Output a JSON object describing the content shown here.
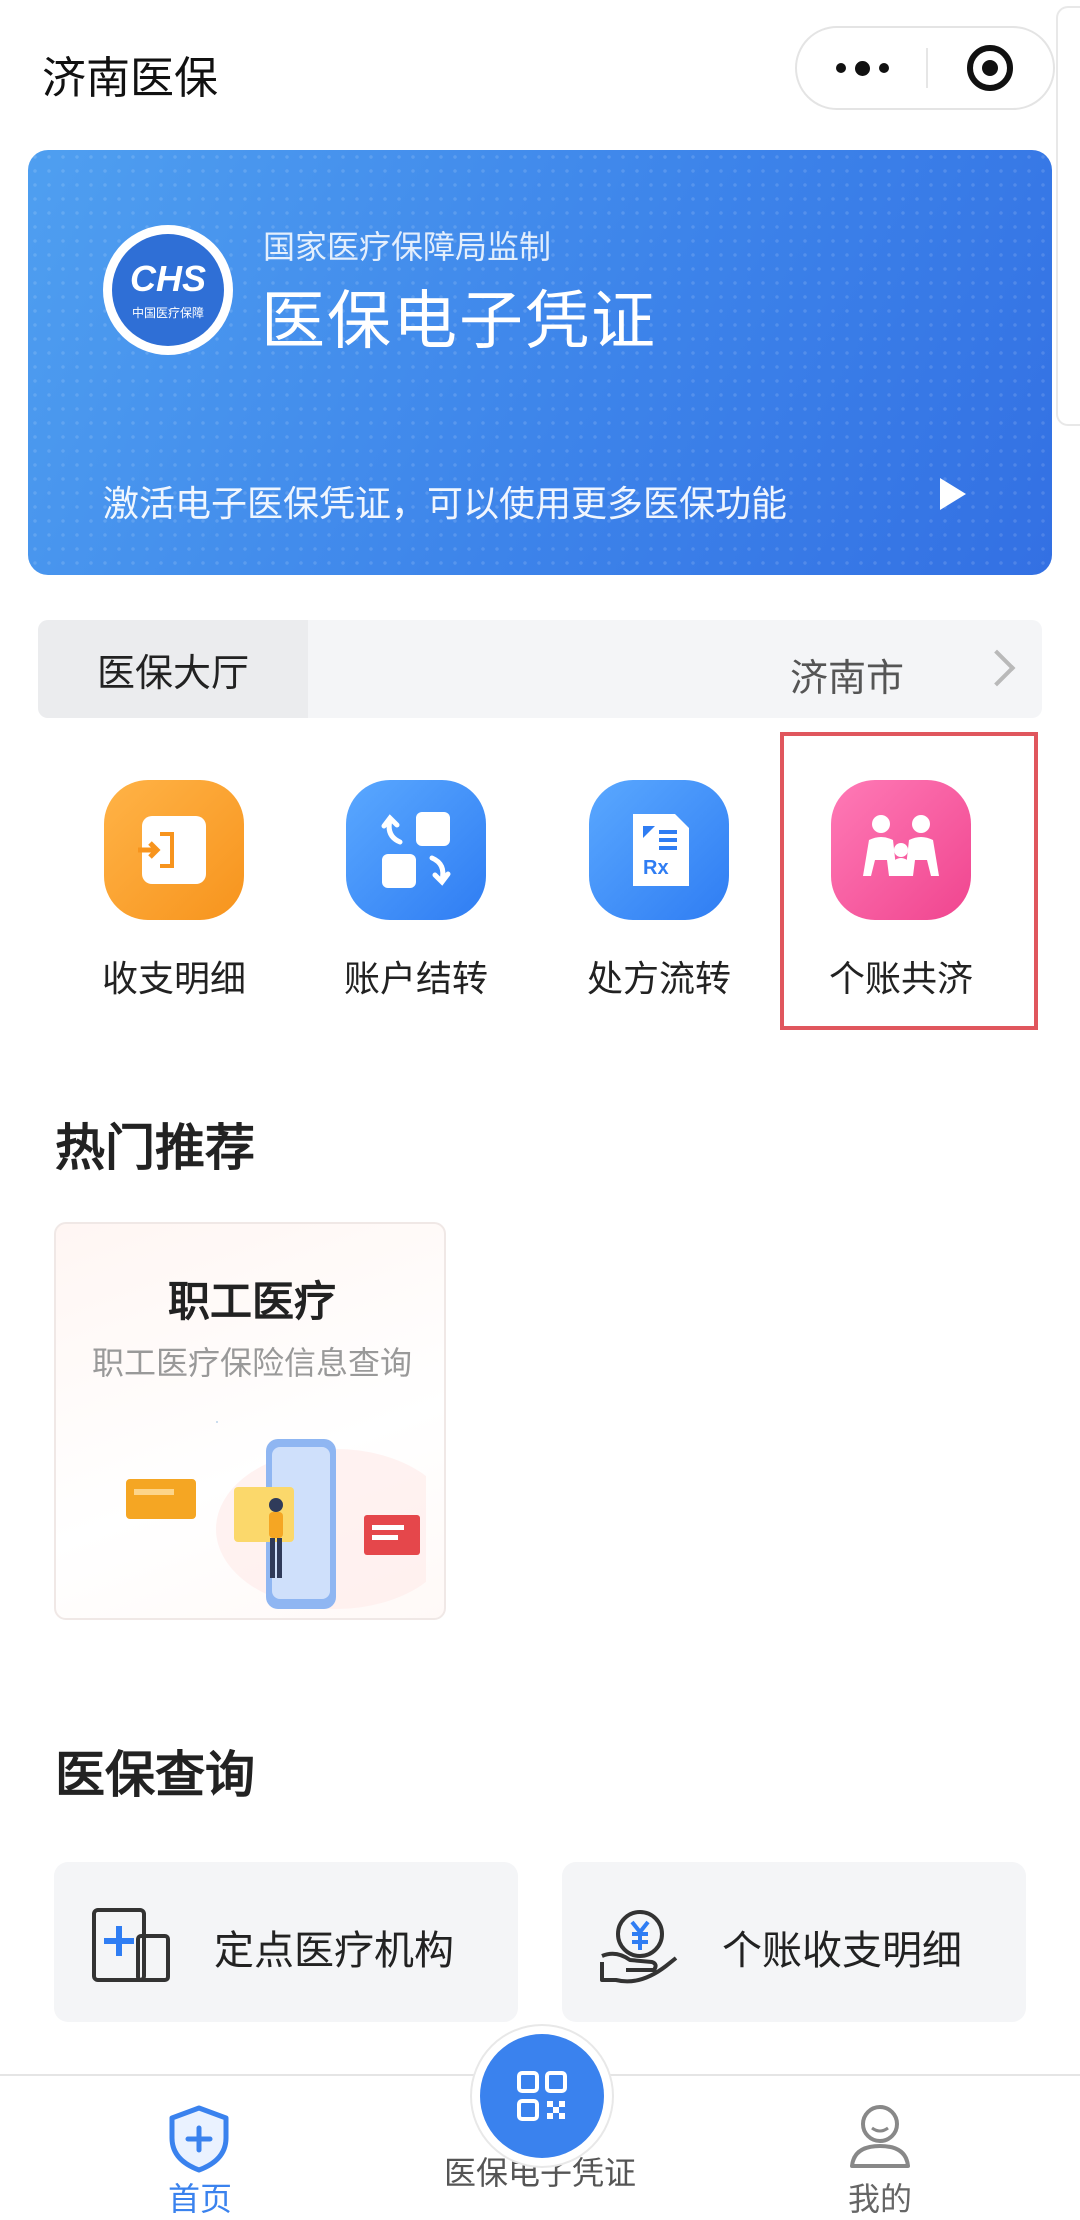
{
  "header": {
    "title": "济南医保"
  },
  "banner": {
    "logo_text": "CHS",
    "logo_subtext": "中国医疗保障",
    "subtitle": "国家医疗保障局监制",
    "title": "医保电子凭证",
    "hint": "激活电子医保凭证，可以使用更多医保功能"
  },
  "hall": {
    "tab_label": "医保大厅",
    "city": "济南市"
  },
  "quick_actions": [
    {
      "label": "收支明细",
      "icon": "income-expense-icon",
      "color": "#f7941d"
    },
    {
      "label": "账户结转",
      "icon": "account-transfer-icon",
      "color": "#2f7df3"
    },
    {
      "label": "处方流转",
      "icon": "prescription-icon",
      "color": "#2f7df3"
    },
    {
      "label": "个账共济",
      "icon": "family-mutual-aid-icon",
      "color": "#f0458f",
      "highlighted": true
    }
  ],
  "hot_section": {
    "title": "热门推荐",
    "card": {
      "title": "职工医疗",
      "subtitle": "职工医疗保险信息查询"
    }
  },
  "query_section": {
    "title": "医保查询",
    "items": [
      {
        "label": "定点医疗机构",
        "icon": "medical-institution-icon"
      },
      {
        "label": "个账收支明细",
        "icon": "account-payment-icon"
      }
    ]
  },
  "tabbar": {
    "items": [
      {
        "label": "首页",
        "icon": "home-shield-icon",
        "active": true
      },
      {
        "label": "医保电子凭证",
        "icon": "qr-code-icon",
        "active": false
      },
      {
        "label": "我的",
        "icon": "user-icon",
        "active": false
      }
    ]
  },
  "colors": {
    "accent": "#3a82ee",
    "highlight_border": "#e0565d"
  }
}
